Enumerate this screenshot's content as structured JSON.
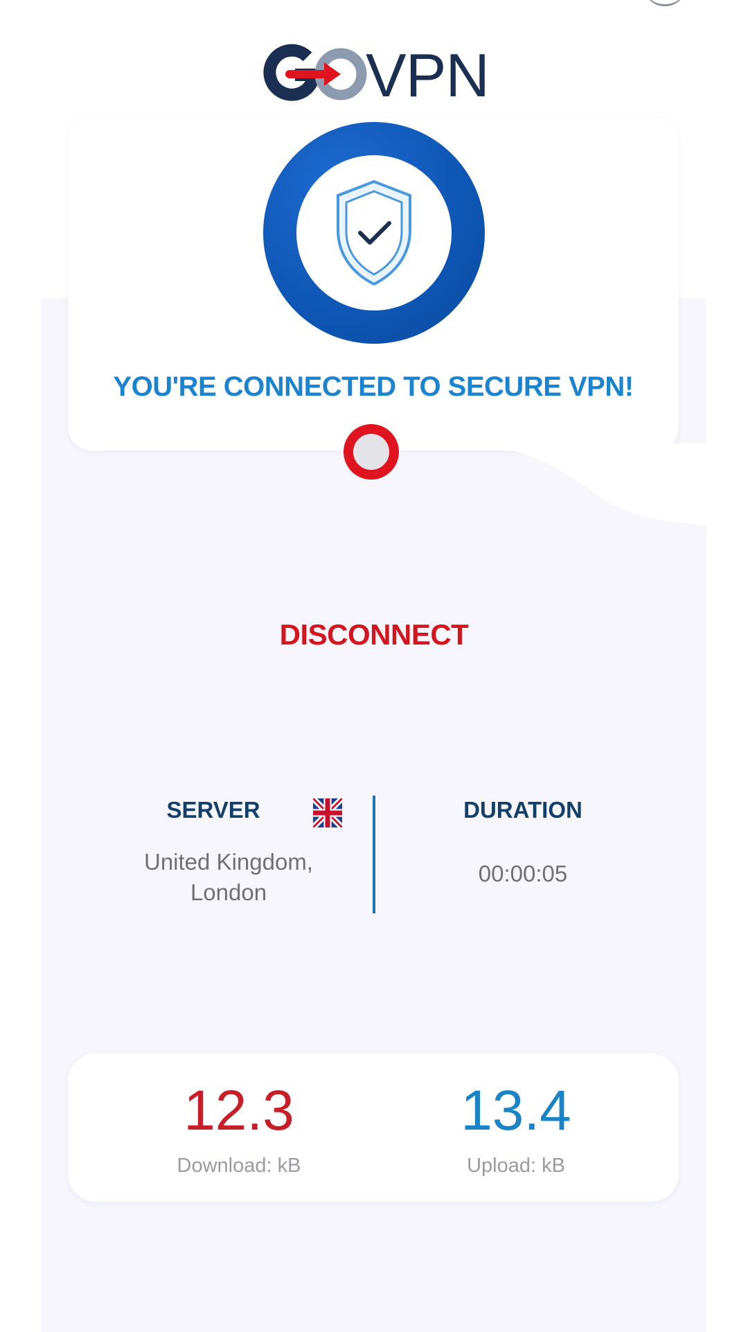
{
  "app": {
    "logo_text": "VPN",
    "logo_letter": "G"
  },
  "status": {
    "message": "YOU'RE CONNECTED TO SECURE VPN!",
    "icon": "shield-check-icon"
  },
  "actions": {
    "disconnect_label": "DISCONNECT",
    "toggle_icon": "power-toggle-icon"
  },
  "server": {
    "heading": "SERVER",
    "location_line1": "United Kingdom,",
    "location_line2": "London",
    "flag_icon": "uk-flag-icon"
  },
  "duration": {
    "heading": "DURATION",
    "value": "00:00:05"
  },
  "stats": {
    "download_value": "12.3",
    "download_label": "Download: kB",
    "upload_value": "13.4",
    "upload_label": "Upload: kB"
  },
  "colors": {
    "brand_navy": "#1a2f52",
    "accent_blue": "#1b84d0",
    "ring_blue": "#0d56b4",
    "disconnect_red": "#d5151e",
    "download_red": "#c81e28",
    "upload_blue": "#1a84c6"
  }
}
